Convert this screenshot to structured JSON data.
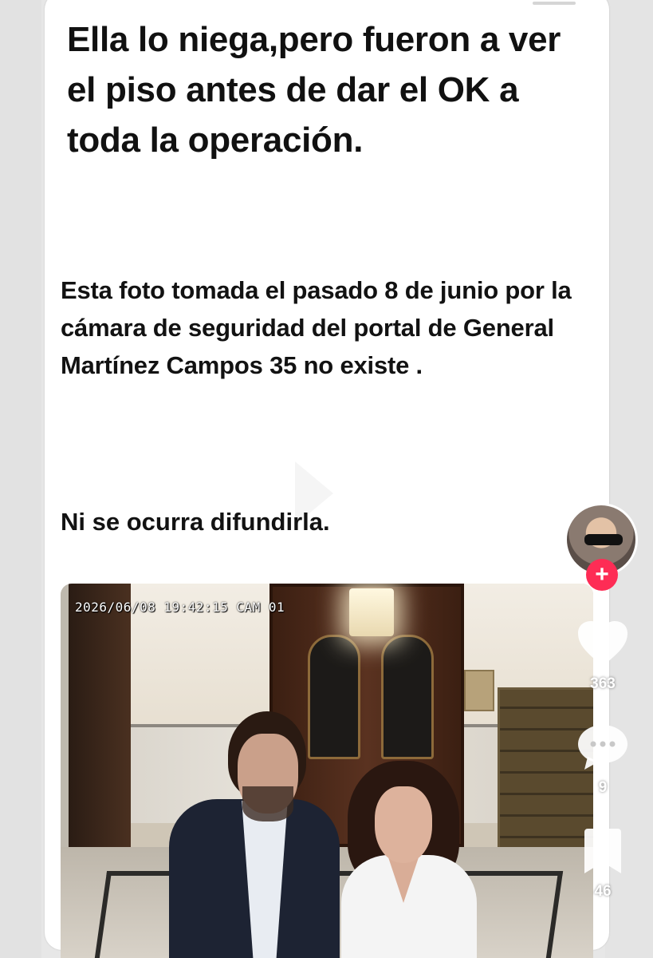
{
  "post": {
    "headline": "Ella lo niega,pero fueron a ver el piso antes de dar el OK a toda la operación.",
    "body": "Esta foto tomada el pasado 8 de junio por la cámara de seguridad del portal de General  Martínez Campos 35  no existe .",
    "warning": "Ni se ocurra difundirla."
  },
  "photo": {
    "date": "2026/06/08",
    "time": "19:42:15",
    "camera": "CAM 01"
  },
  "actions": {
    "follow_label": "+",
    "likes": "363",
    "comments": "9",
    "saves": "46"
  },
  "colors": {
    "follow": "#fe2c55",
    "text": "#111111",
    "card": "#ffffff"
  }
}
